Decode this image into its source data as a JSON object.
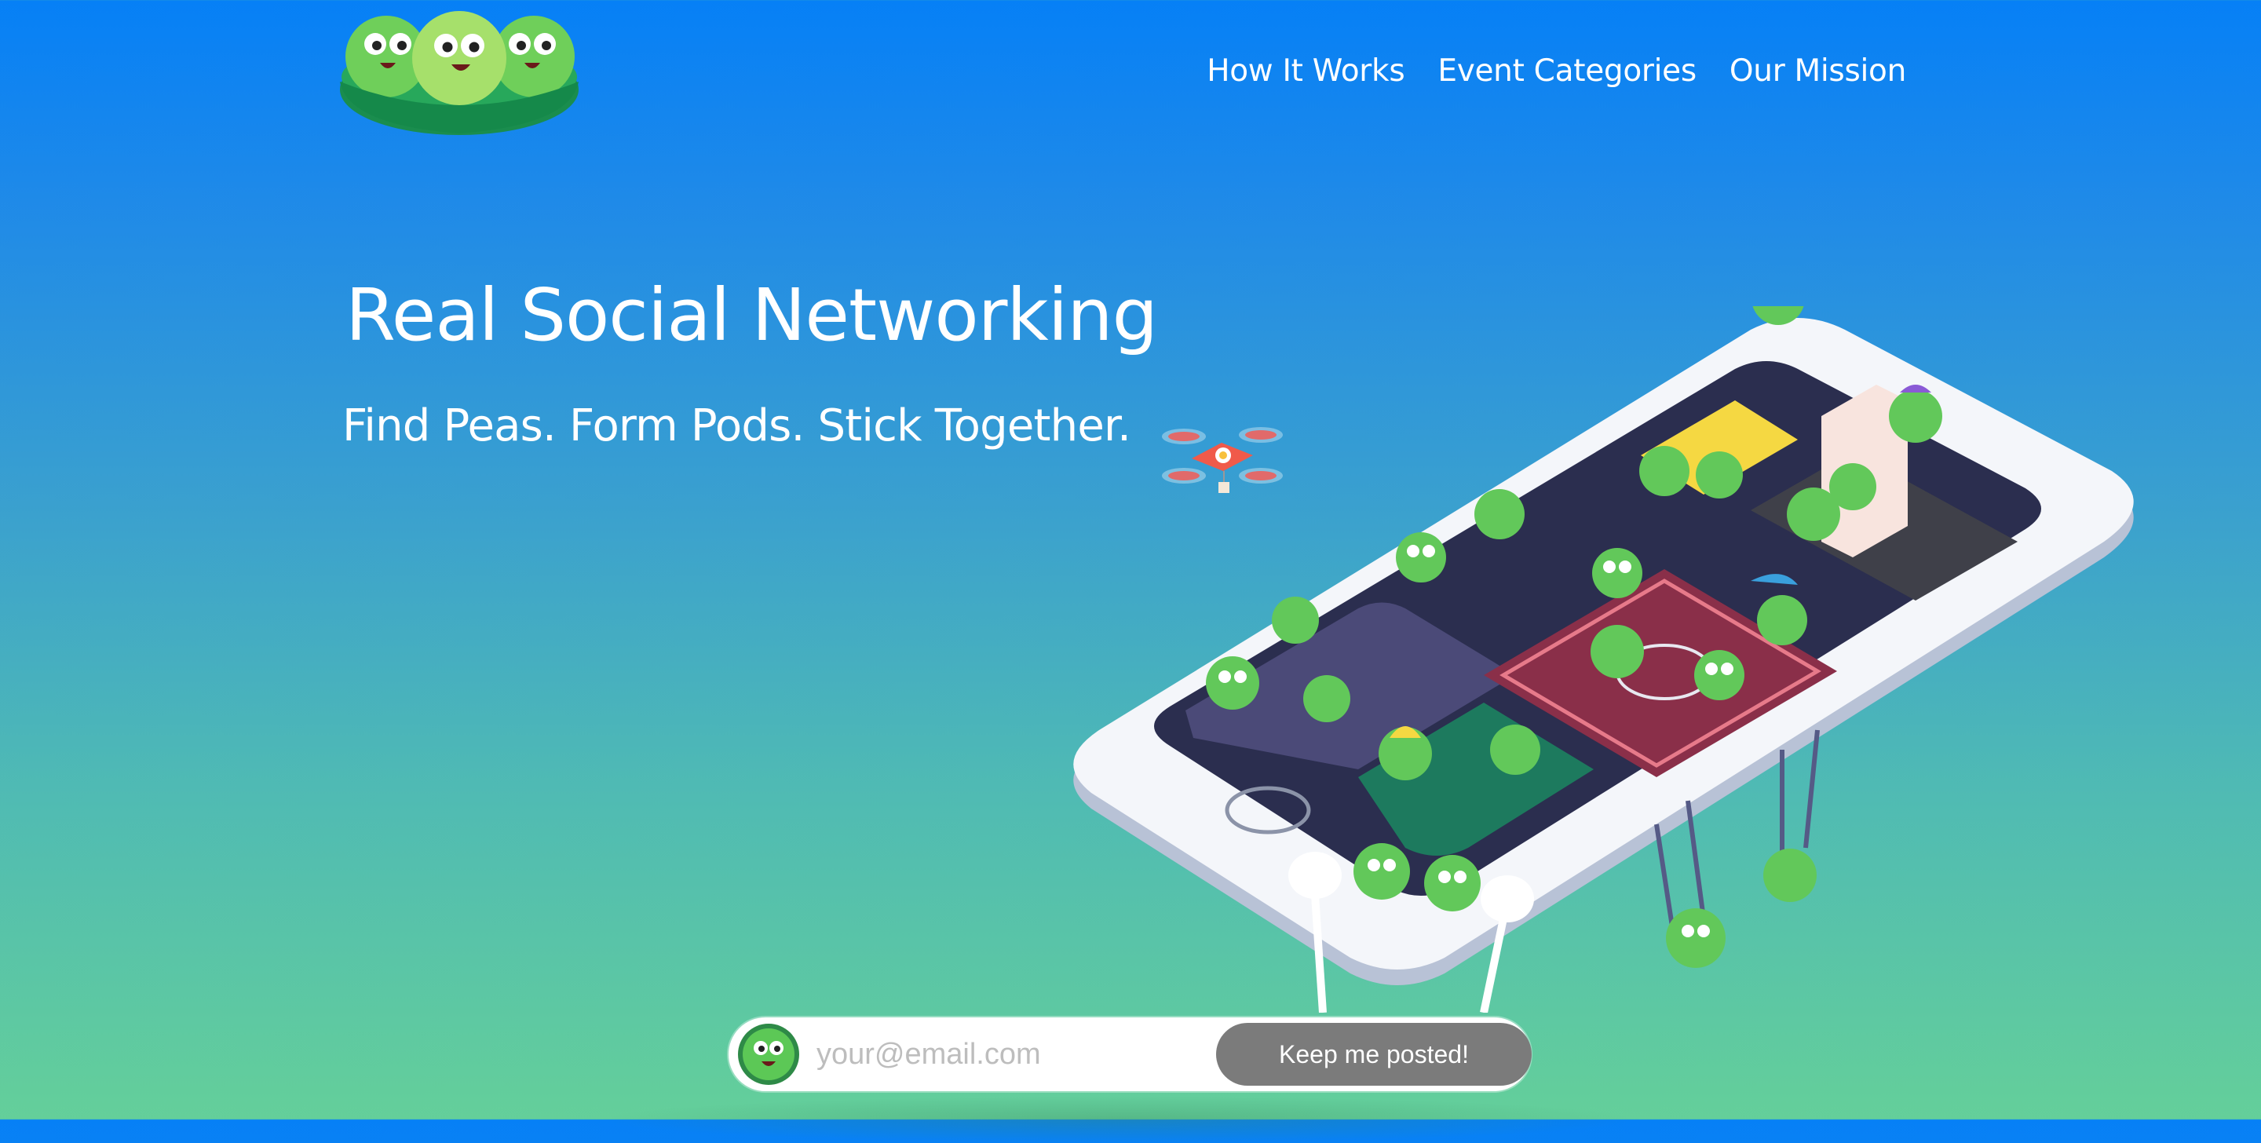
{
  "brand": {
    "logo_icon": "pea-pod-logo"
  },
  "nav": {
    "items": [
      {
        "label": "How It Works"
      },
      {
        "label": "Event Categories"
      },
      {
        "label": "Our Mission"
      }
    ]
  },
  "hero": {
    "headline": "Real Social Networking",
    "tagline": "Find Peas. Form Pods. Stick Together."
  },
  "signup": {
    "placeholder": "your@email.com",
    "value": "",
    "button_label": "Keep me posted!",
    "avatar_icon": "pea-face-icon"
  },
  "colors": {
    "gradient_top": "#0680f6",
    "gradient_bottom": "#64cf9a",
    "button": "#7b7b7b",
    "pea_green": "#5cc856"
  }
}
